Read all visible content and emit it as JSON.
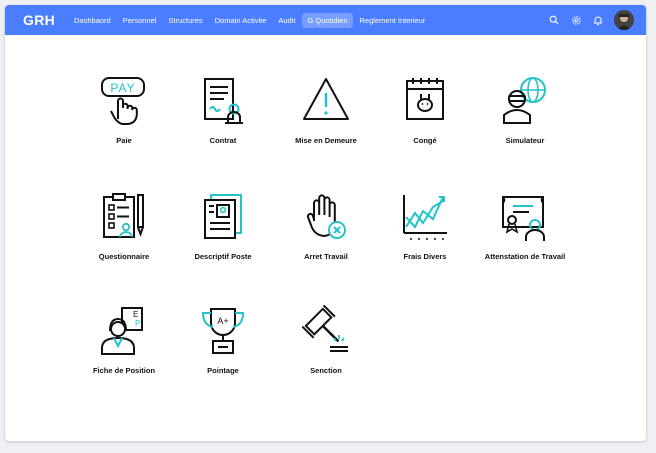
{
  "nav": {
    "brand": "GRH",
    "items": [
      {
        "label": "Dashbaord"
      },
      {
        "label": "Personnel"
      },
      {
        "label": "Structures"
      },
      {
        "label": "Domain Activite"
      },
      {
        "label": "Audit"
      },
      {
        "label": "G Quotidien",
        "active": true
      },
      {
        "label": "Reglement Interieur"
      }
    ],
    "icons": [
      "search-icon",
      "gear-icon",
      "bell-icon"
    ]
  },
  "tiles": [
    {
      "label": "Paie",
      "icon": "pay-hand-icon"
    },
    {
      "label": "Contrat",
      "icon": "contract-icon"
    },
    {
      "label": "Mise en Demeure",
      "icon": "warning-icon"
    },
    {
      "label": "Congé",
      "icon": "calendar-icon"
    },
    {
      "label": "Simulateur",
      "icon": "simulator-globe-icon"
    },
    {
      "label": "Questionnaire",
      "icon": "questionnaire-icon"
    },
    {
      "label": "Descriptif Poste",
      "icon": "job-description-icon"
    },
    {
      "label": "Arret Travail",
      "icon": "stop-hand-icon"
    },
    {
      "label": "Frais Divers",
      "icon": "chart-icon"
    },
    {
      "label": "Attenstation de Travail",
      "icon": "certificate-icon"
    },
    {
      "label": "Fiche de Position",
      "icon": "position-sheet-icon"
    },
    {
      "label": "Pointage",
      "icon": "trophy-icon"
    },
    {
      "label": "Senction",
      "icon": "gavel-icon"
    }
  ],
  "colors": {
    "accent": "#4a7dff",
    "icon_teal": "#22c3c9",
    "icon_stroke": "#111111"
  }
}
